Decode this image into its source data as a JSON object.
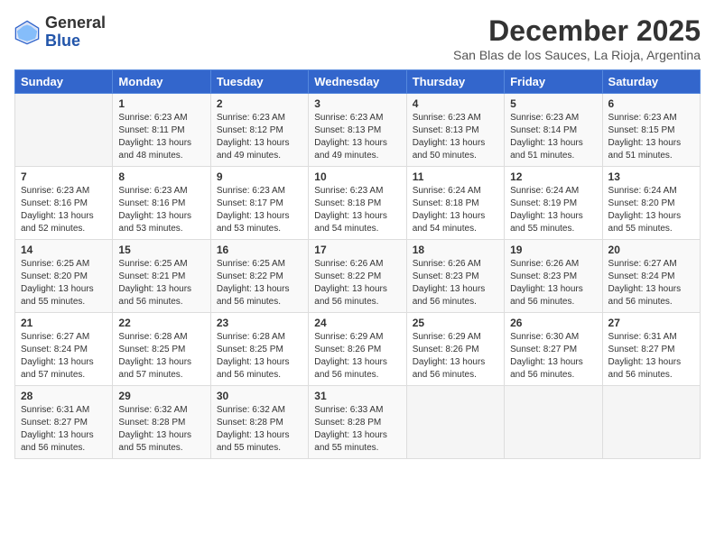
{
  "logo": {
    "general": "General",
    "blue": "Blue"
  },
  "title": "December 2025",
  "subtitle": "San Blas de los Sauces, La Rioja, Argentina",
  "days_header": [
    "Sunday",
    "Monday",
    "Tuesday",
    "Wednesday",
    "Thursday",
    "Friday",
    "Saturday"
  ],
  "weeks": [
    [
      {
        "day": "",
        "info": ""
      },
      {
        "day": "1",
        "info": "Sunrise: 6:23 AM\nSunset: 8:11 PM\nDaylight: 13 hours\nand 48 minutes."
      },
      {
        "day": "2",
        "info": "Sunrise: 6:23 AM\nSunset: 8:12 PM\nDaylight: 13 hours\nand 49 minutes."
      },
      {
        "day": "3",
        "info": "Sunrise: 6:23 AM\nSunset: 8:13 PM\nDaylight: 13 hours\nand 49 minutes."
      },
      {
        "day": "4",
        "info": "Sunrise: 6:23 AM\nSunset: 8:13 PM\nDaylight: 13 hours\nand 50 minutes."
      },
      {
        "day": "5",
        "info": "Sunrise: 6:23 AM\nSunset: 8:14 PM\nDaylight: 13 hours\nand 51 minutes."
      },
      {
        "day": "6",
        "info": "Sunrise: 6:23 AM\nSunset: 8:15 PM\nDaylight: 13 hours\nand 51 minutes."
      }
    ],
    [
      {
        "day": "7",
        "info": "Sunrise: 6:23 AM\nSunset: 8:16 PM\nDaylight: 13 hours\nand 52 minutes."
      },
      {
        "day": "8",
        "info": "Sunrise: 6:23 AM\nSunset: 8:16 PM\nDaylight: 13 hours\nand 53 minutes."
      },
      {
        "day": "9",
        "info": "Sunrise: 6:23 AM\nSunset: 8:17 PM\nDaylight: 13 hours\nand 53 minutes."
      },
      {
        "day": "10",
        "info": "Sunrise: 6:23 AM\nSunset: 8:18 PM\nDaylight: 13 hours\nand 54 minutes."
      },
      {
        "day": "11",
        "info": "Sunrise: 6:24 AM\nSunset: 8:18 PM\nDaylight: 13 hours\nand 54 minutes."
      },
      {
        "day": "12",
        "info": "Sunrise: 6:24 AM\nSunset: 8:19 PM\nDaylight: 13 hours\nand 55 minutes."
      },
      {
        "day": "13",
        "info": "Sunrise: 6:24 AM\nSunset: 8:20 PM\nDaylight: 13 hours\nand 55 minutes."
      }
    ],
    [
      {
        "day": "14",
        "info": "Sunrise: 6:25 AM\nSunset: 8:20 PM\nDaylight: 13 hours\nand 55 minutes."
      },
      {
        "day": "15",
        "info": "Sunrise: 6:25 AM\nSunset: 8:21 PM\nDaylight: 13 hours\nand 56 minutes."
      },
      {
        "day": "16",
        "info": "Sunrise: 6:25 AM\nSunset: 8:22 PM\nDaylight: 13 hours\nand 56 minutes."
      },
      {
        "day": "17",
        "info": "Sunrise: 6:26 AM\nSunset: 8:22 PM\nDaylight: 13 hours\nand 56 minutes."
      },
      {
        "day": "18",
        "info": "Sunrise: 6:26 AM\nSunset: 8:23 PM\nDaylight: 13 hours\nand 56 minutes."
      },
      {
        "day": "19",
        "info": "Sunrise: 6:26 AM\nSunset: 8:23 PM\nDaylight: 13 hours\nand 56 minutes."
      },
      {
        "day": "20",
        "info": "Sunrise: 6:27 AM\nSunset: 8:24 PM\nDaylight: 13 hours\nand 56 minutes."
      }
    ],
    [
      {
        "day": "21",
        "info": "Sunrise: 6:27 AM\nSunset: 8:24 PM\nDaylight: 13 hours\nand 57 minutes."
      },
      {
        "day": "22",
        "info": "Sunrise: 6:28 AM\nSunset: 8:25 PM\nDaylight: 13 hours\nand 57 minutes."
      },
      {
        "day": "23",
        "info": "Sunrise: 6:28 AM\nSunset: 8:25 PM\nDaylight: 13 hours\nand 56 minutes."
      },
      {
        "day": "24",
        "info": "Sunrise: 6:29 AM\nSunset: 8:26 PM\nDaylight: 13 hours\nand 56 minutes."
      },
      {
        "day": "25",
        "info": "Sunrise: 6:29 AM\nSunset: 8:26 PM\nDaylight: 13 hours\nand 56 minutes."
      },
      {
        "day": "26",
        "info": "Sunrise: 6:30 AM\nSunset: 8:27 PM\nDaylight: 13 hours\nand 56 minutes."
      },
      {
        "day": "27",
        "info": "Sunrise: 6:31 AM\nSunset: 8:27 PM\nDaylight: 13 hours\nand 56 minutes."
      }
    ],
    [
      {
        "day": "28",
        "info": "Sunrise: 6:31 AM\nSunset: 8:27 PM\nDaylight: 13 hours\nand 56 minutes."
      },
      {
        "day": "29",
        "info": "Sunrise: 6:32 AM\nSunset: 8:28 PM\nDaylight: 13 hours\nand 55 minutes."
      },
      {
        "day": "30",
        "info": "Sunrise: 6:32 AM\nSunset: 8:28 PM\nDaylight: 13 hours\nand 55 minutes."
      },
      {
        "day": "31",
        "info": "Sunrise: 6:33 AM\nSunset: 8:28 PM\nDaylight: 13 hours\nand 55 minutes."
      },
      {
        "day": "",
        "info": ""
      },
      {
        "day": "",
        "info": ""
      },
      {
        "day": "",
        "info": ""
      }
    ]
  ]
}
